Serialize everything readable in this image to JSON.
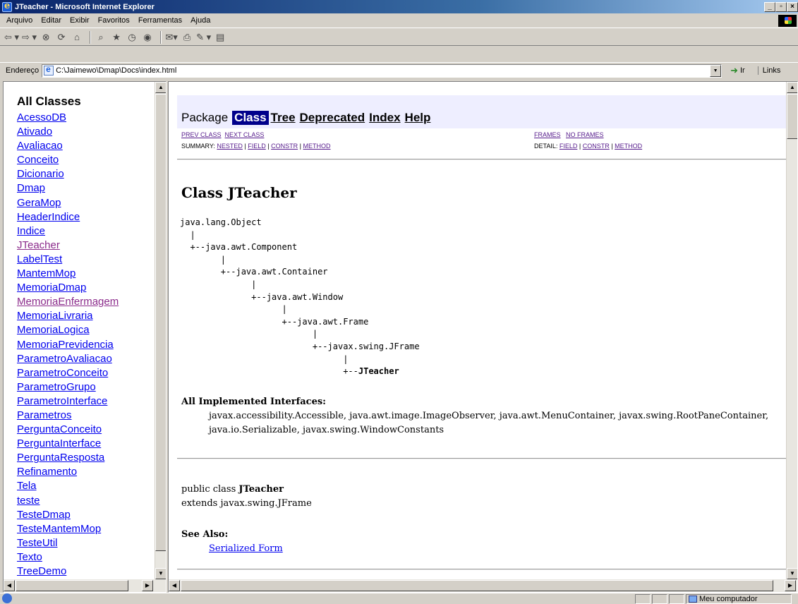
{
  "window": {
    "title": "JTeacher - Microsoft Internet Explorer",
    "controls": [
      "_",
      "×"
    ]
  },
  "menu": [
    "Arquivo",
    "Editar",
    "Exibir",
    "Favoritos",
    "Ferramentas",
    "Ajuda"
  ],
  "toolbar": {
    "buttons": [
      "back-icon",
      "forward-icon",
      "stop-icon",
      "refresh-icon",
      "home-icon",
      "search-icon",
      "favorites-icon",
      "history-icon",
      "mail-icon",
      "print-icon",
      "edit-icon",
      "discuss-icon"
    ]
  },
  "address": {
    "label": "Endereço",
    "value": "C:\\Jaimewo\\Dmap\\Docs\\index.html",
    "go_label": "Ir",
    "links_label": "Links"
  },
  "left": {
    "heading": "All Classes",
    "classes": [
      {
        "name": "AcessoDB",
        "visited": false
      },
      {
        "name": "Ativado",
        "visited": false
      },
      {
        "name": "Avaliacao",
        "visited": false
      },
      {
        "name": "Conceito",
        "visited": false
      },
      {
        "name": "Dicionario",
        "visited": false
      },
      {
        "name": "Dmap",
        "visited": false
      },
      {
        "name": "GeraMop",
        "visited": false
      },
      {
        "name": "HeaderIndice",
        "visited": false
      },
      {
        "name": "Indice",
        "visited": false
      },
      {
        "name": "JTeacher",
        "visited": true
      },
      {
        "name": "LabelTest",
        "visited": false
      },
      {
        "name": "MantemMop",
        "visited": false
      },
      {
        "name": "MemoriaDmap",
        "visited": false
      },
      {
        "name": "MemoriaEnfermagem",
        "visited": true
      },
      {
        "name": "MemoriaLivraria",
        "visited": false
      },
      {
        "name": "MemoriaLogica",
        "visited": false
      },
      {
        "name": "MemoriaPrevidencia",
        "visited": false
      },
      {
        "name": "ParametroAvaliacao",
        "visited": false
      },
      {
        "name": "ParametroConceito",
        "visited": false
      },
      {
        "name": "ParametroGrupo",
        "visited": false
      },
      {
        "name": "ParametroInterface",
        "visited": false
      },
      {
        "name": "Parametros",
        "visited": false
      },
      {
        "name": "PerguntaConceito",
        "visited": false
      },
      {
        "name": "PerguntaInterface",
        "visited": false
      },
      {
        "name": "PerguntaResposta",
        "visited": false
      },
      {
        "name": "Refinamento",
        "visited": false
      },
      {
        "name": "Tela",
        "visited": false
      },
      {
        "name": "teste",
        "visited": false
      },
      {
        "name": "TesteDmap",
        "visited": false
      },
      {
        "name": "TesteMantemMop",
        "visited": false
      },
      {
        "name": "TesteUtil",
        "visited": false
      },
      {
        "name": "Texto",
        "visited": false
      },
      {
        "name": "TreeDemo",
        "visited": false
      }
    ]
  },
  "nav": {
    "package": "Package",
    "class": "Class",
    "tree": "Tree",
    "deprecated": "Deprecated",
    "index": "Index",
    "help": "Help",
    "prev_class": "PREV CLASS",
    "next_class": "NEXT CLASS",
    "frames": "FRAMES",
    "no_frames": "NO FRAMES",
    "summary_label": "SUMMARY:",
    "detail_label": "DETAIL:",
    "nested": "NESTED",
    "field": "FIELD",
    "constr": "CONSTR",
    "method": "METHOD",
    "sep": "|"
  },
  "doc": {
    "class_title": "Class JTeacher",
    "tree_lines": [
      "java.lang.Object",
      "  |",
      "  +--java.awt.Component",
      "        |",
      "        +--java.awt.Container",
      "              |",
      "              +--java.awt.Window",
      "                    |",
      "                    +--java.awt.Frame",
      "                          |",
      "                          +--javax.swing.JFrame",
      "                                |"
    ],
    "tree_last_prefix": "                                +--",
    "tree_last": "JTeacher",
    "interfaces_label": "All Implemented Interfaces:",
    "interfaces_line1": "javax.accessibility.Accessible, java.awt.image.ImageObserver, java.awt.MenuContainer, javax.swing.RootPaneContainer,",
    "interfaces_line2": "java.io.Serializable, javax.swing.WindowConstants",
    "decl_prefix": "public class ",
    "decl_name": "JTeacher",
    "extends": "extends javax.swing.JFrame",
    "see_also_label": "See Also:",
    "serialized_form": "Serialized Form"
  },
  "status": {
    "zone": "Meu computador"
  }
}
